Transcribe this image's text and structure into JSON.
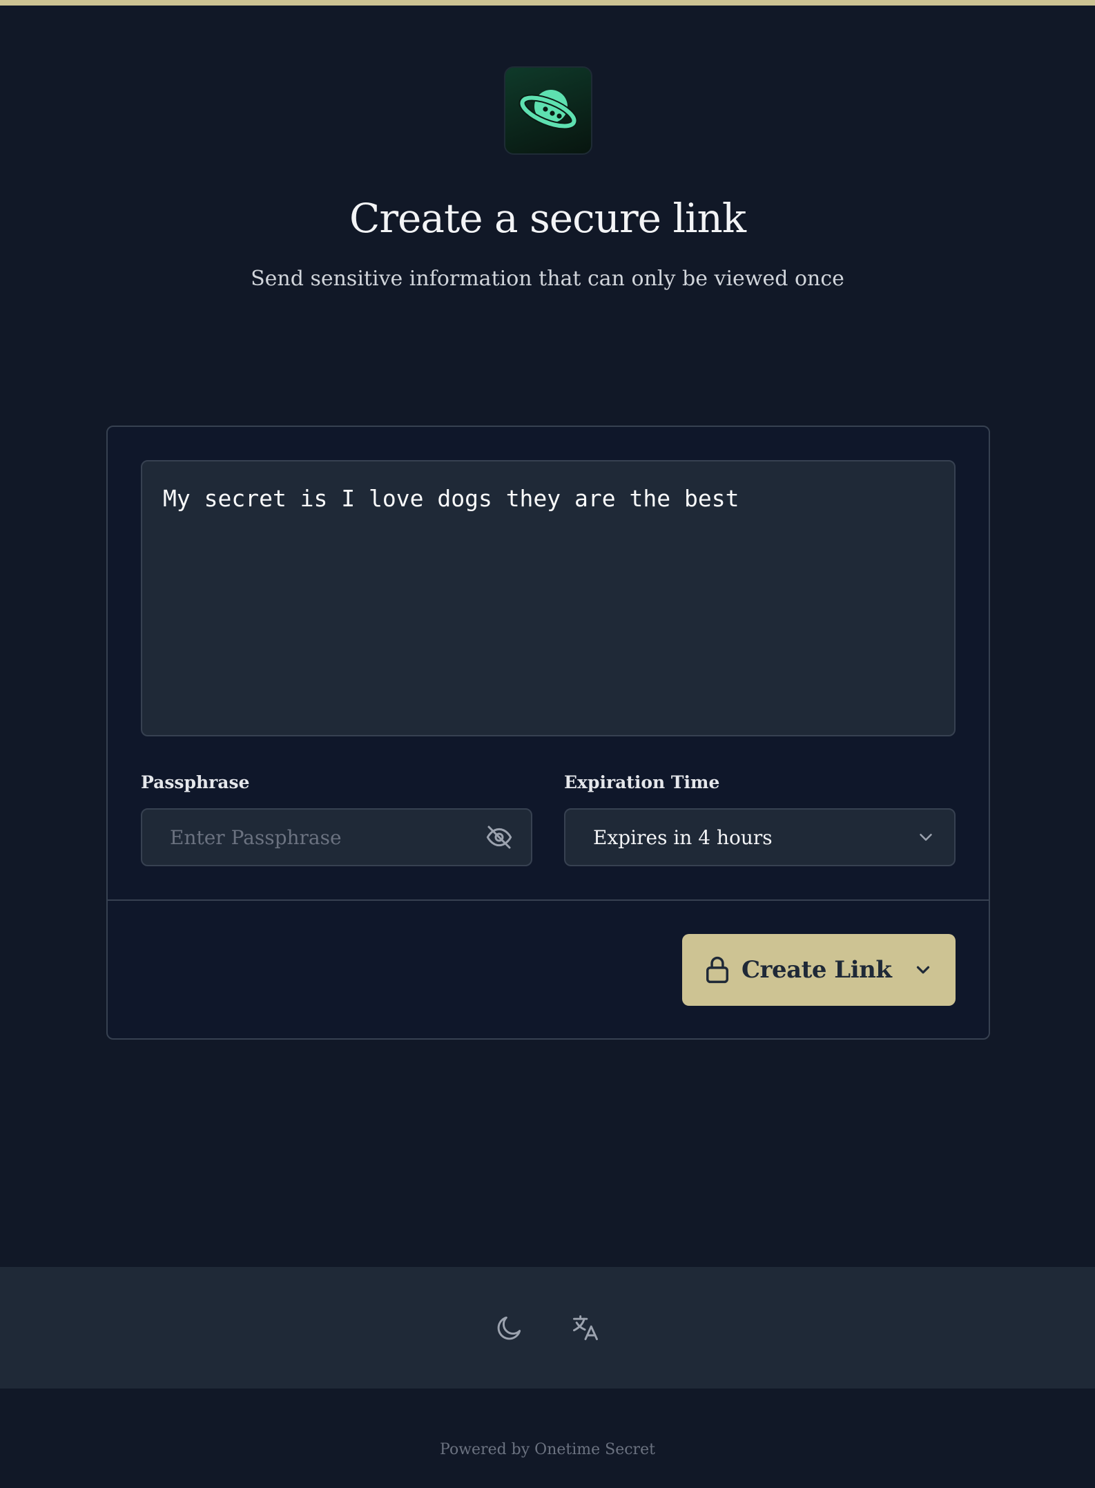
{
  "header": {
    "logo_icon": "planet-icon",
    "title": "Create a secure link",
    "subtitle": "Send sensitive information that can only be viewed once"
  },
  "form": {
    "secret_value": "My secret is I love dogs they are the best",
    "passphrase": {
      "label": "Passphrase",
      "placeholder": "Enter Passphrase",
      "value": "",
      "toggle_icon": "eye-off-icon"
    },
    "expiration": {
      "label": "Expiration Time",
      "selected": "Expires in 4 hours",
      "icon": "chevron-down-icon"
    },
    "submit": {
      "label": "Create Link",
      "icon": "lock-icon",
      "menu_icon": "chevron-down-icon"
    }
  },
  "footer": {
    "theme_icon": "moon-icon",
    "language_icon": "translate-icon",
    "powered_by": "Powered by Onetime Secret"
  },
  "colors": {
    "background": "#111827",
    "accent": "#cdc393",
    "card": "#0f172a",
    "field": "#1f2937",
    "border": "#374151",
    "logo_green": "#5ee0b0"
  }
}
